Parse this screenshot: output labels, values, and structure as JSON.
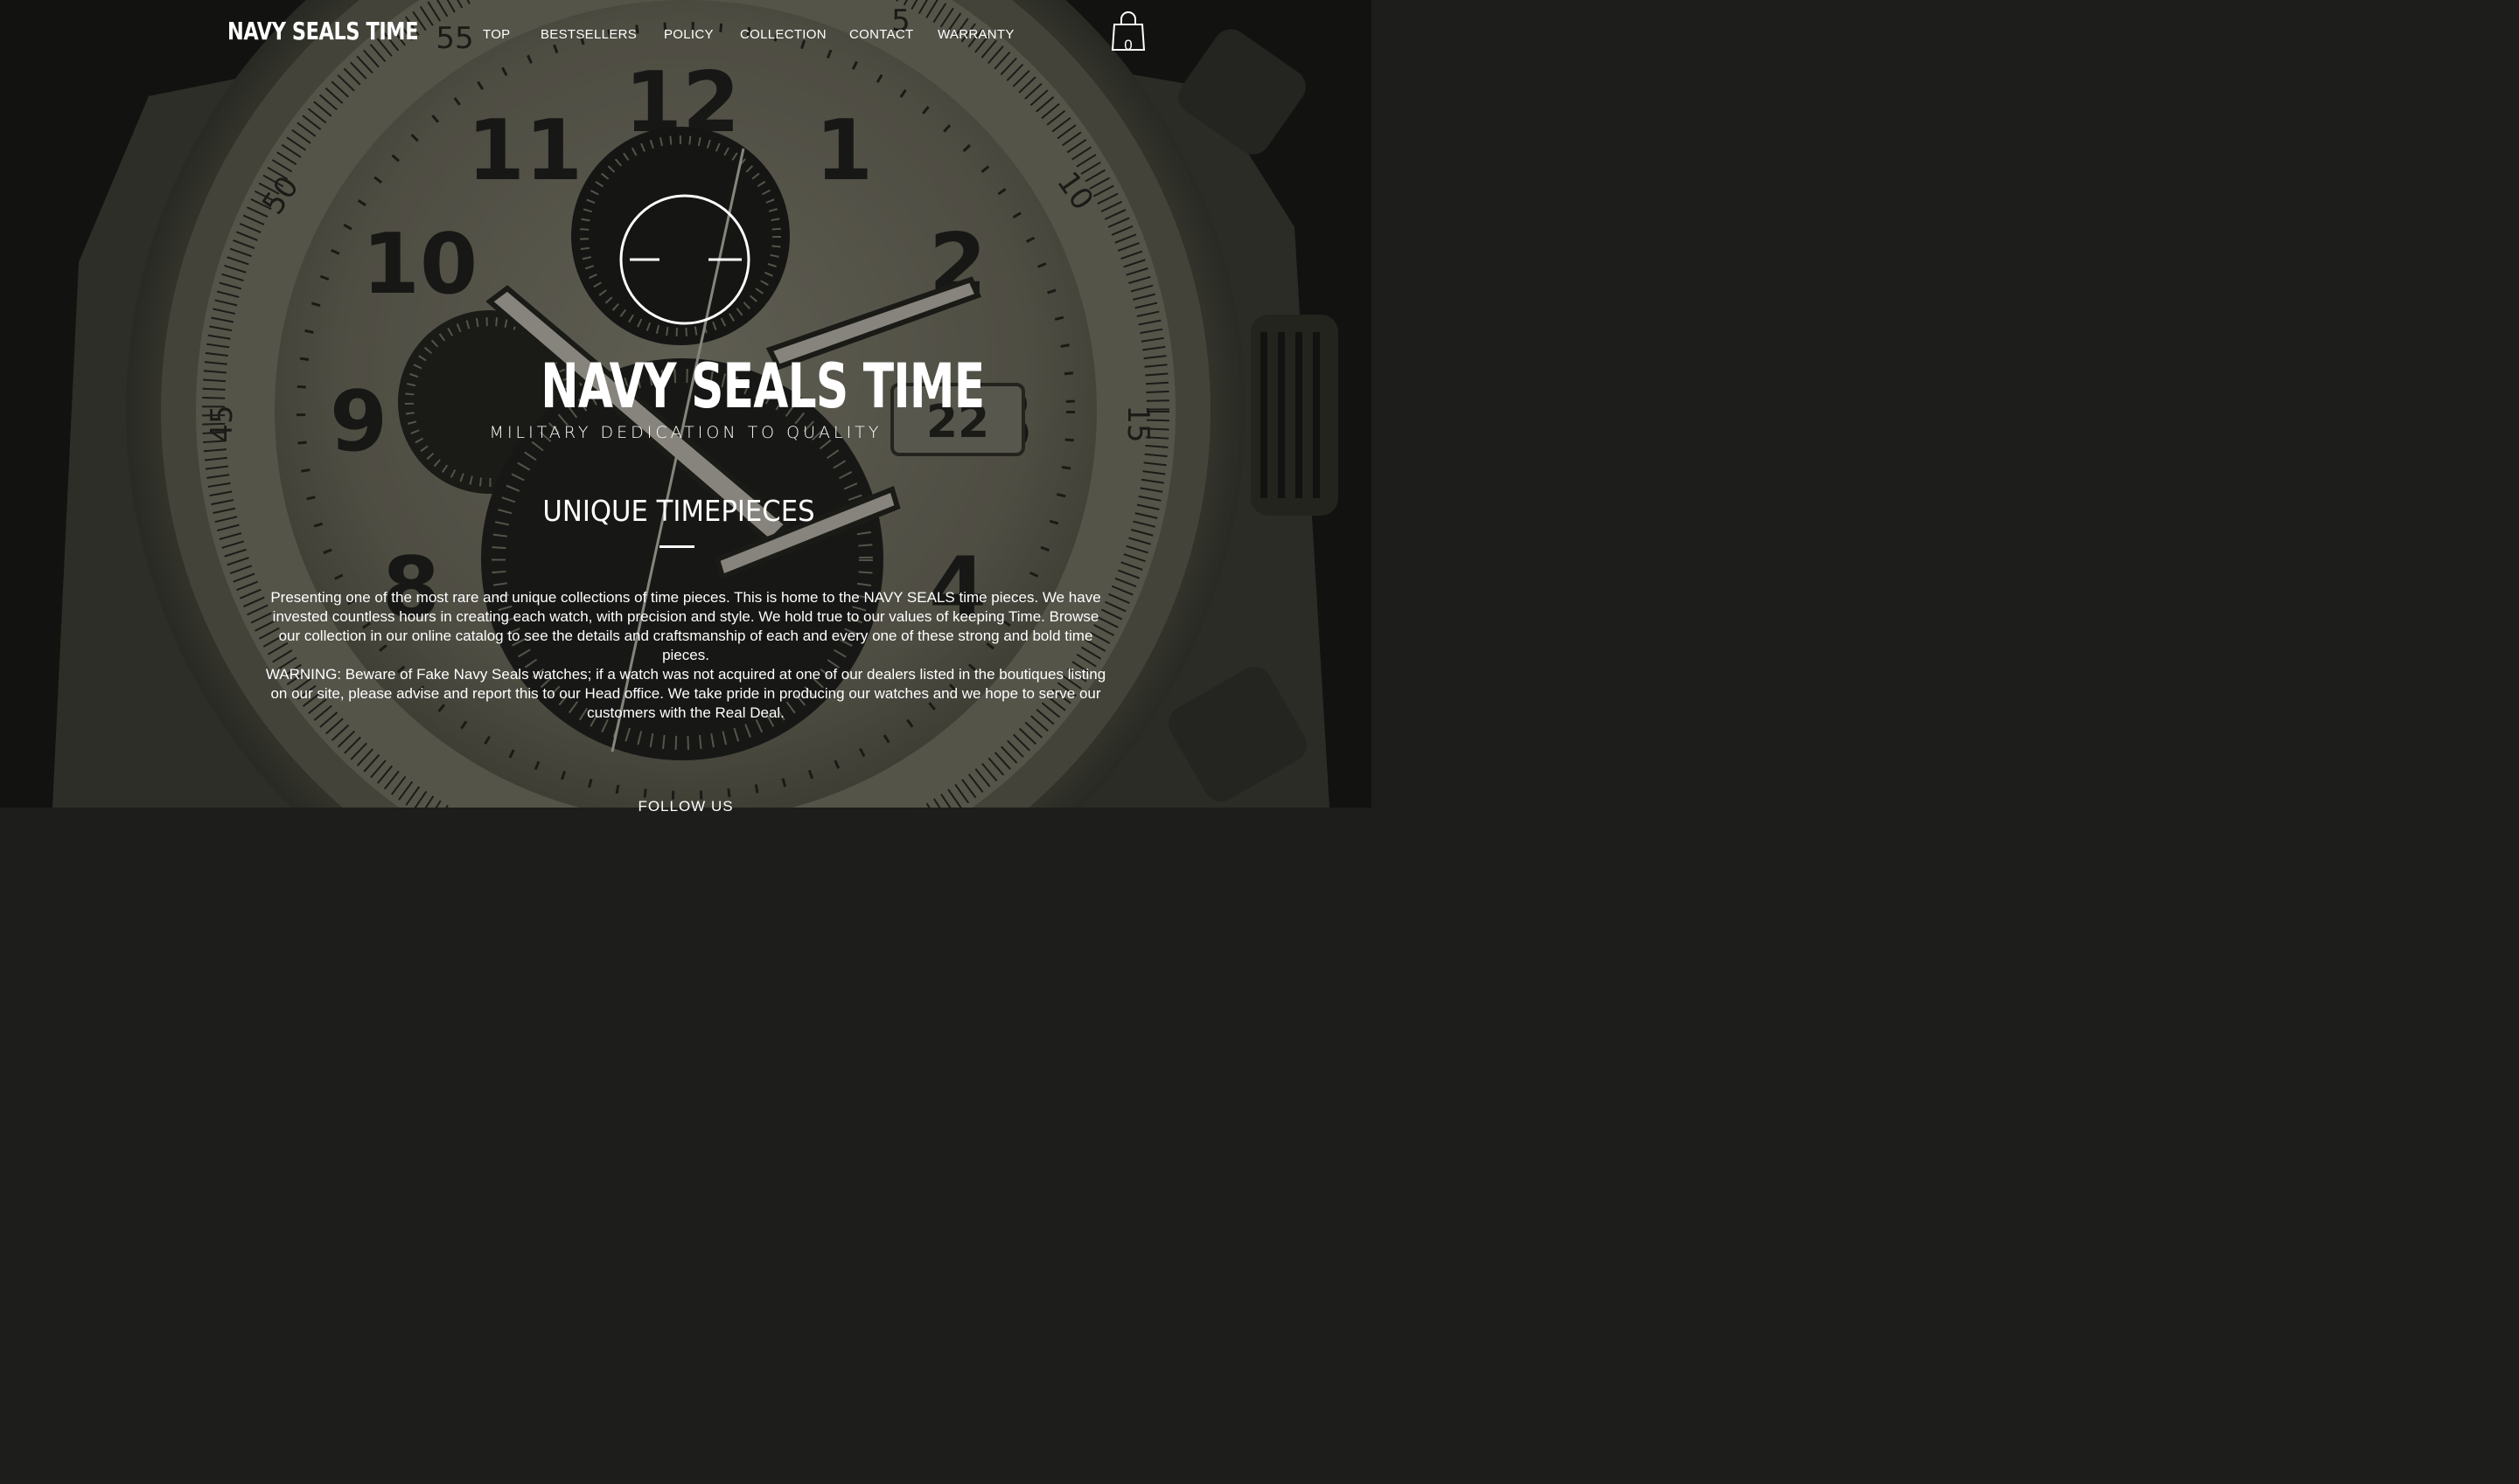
{
  "header": {
    "logo": "NAVY SEALS TIME",
    "nav": [
      {
        "label": "TOP"
      },
      {
        "label": "BESTSELLERS"
      },
      {
        "label": "POLICY"
      },
      {
        "label": "COLLECTION"
      },
      {
        "label": "CONTACT"
      },
      {
        "label": "WARRANTY"
      }
    ],
    "cart": {
      "icon": "shopping-bag-icon",
      "count": "0"
    }
  },
  "hero": {
    "emblem_icon": "crosshair-circle-icon",
    "title": "NAVY SEALS TIME",
    "subtitle": "MILITARY DEDICATION TO QUALITY",
    "background": "watch-dial-photo"
  },
  "intro": {
    "heading": "UNIQUE TIMEPIECES",
    "paragraph1": "Presenting one of the most rare and unique collections of time pieces. This is home to the NAVY SEALS time pieces. We have invested countless hours in creating each watch, with precision and style. We hold true to our values of keeping Time. Browse our collection in our online catalog to see the details and craftsmanship of each and every one of these strong and bold time pieces.",
    "paragraph2": "WARNING: Beware of Fake Navy Seals watches; if a watch was not acquired at one of our dealers listed in the boutiques listing on our site, please advise and report this to our Head office. We take pride in producing our watches and we hope to serve our customers with the Real Deal."
  },
  "follow": {
    "label": "FOLLOW US"
  },
  "colors": {
    "text": "#ffffff",
    "dial": "#8c8a78",
    "dark": "#1d1d1b"
  }
}
